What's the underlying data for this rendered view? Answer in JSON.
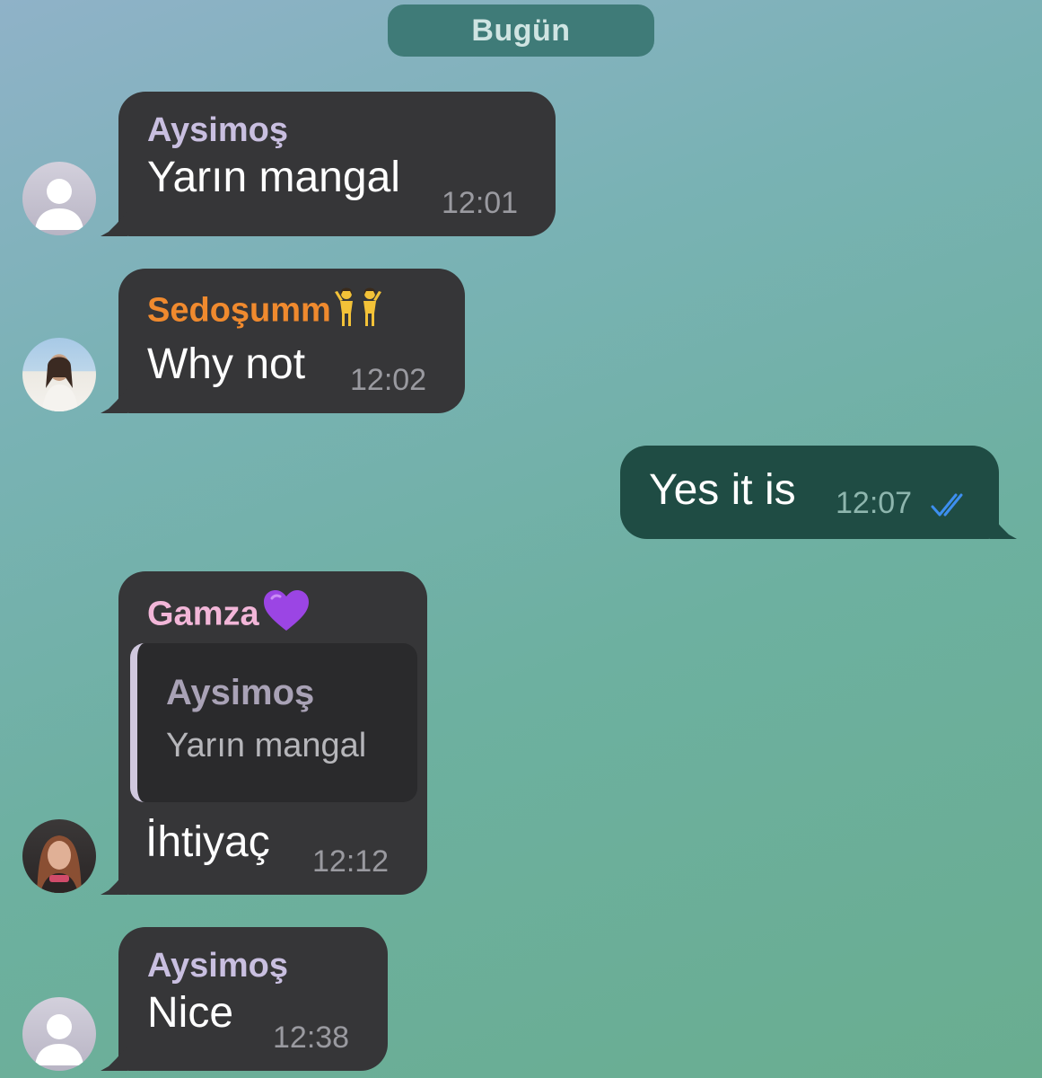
{
  "chat": {
    "date_separator": "Bugün",
    "messages": [
      {
        "sender": "Aysimoş",
        "sender_color": "#c9bfe0",
        "text": "Yarın mangal",
        "time": "12:01",
        "avatar": "default-avatar-icon"
      },
      {
        "sender": "Sedoşumm",
        "sender_color": "#f08a2e",
        "sender_emoji": "dancers-emoji",
        "text": "Why not",
        "time": "12:02",
        "avatar": "profile-photo"
      },
      {
        "outgoing": true,
        "text": "Yes it is",
        "time": "12:07",
        "status_icon": "double-check-icon",
        "status_color": "#3d8ff0"
      },
      {
        "sender": "Gamza",
        "sender_color": "#f2b6d8",
        "sender_emoji": "purple-heart-emoji",
        "reply_to": {
          "sender": "Aysimoş",
          "text": "Yarın mangal"
        },
        "text": "İhtiyaç",
        "time": "12:12",
        "avatar": "profile-photo"
      },
      {
        "sender": "Aysimoş",
        "sender_color": "#c9bfe0",
        "text": "Nice",
        "time": "12:38",
        "avatar": "default-avatar-icon"
      }
    ]
  }
}
